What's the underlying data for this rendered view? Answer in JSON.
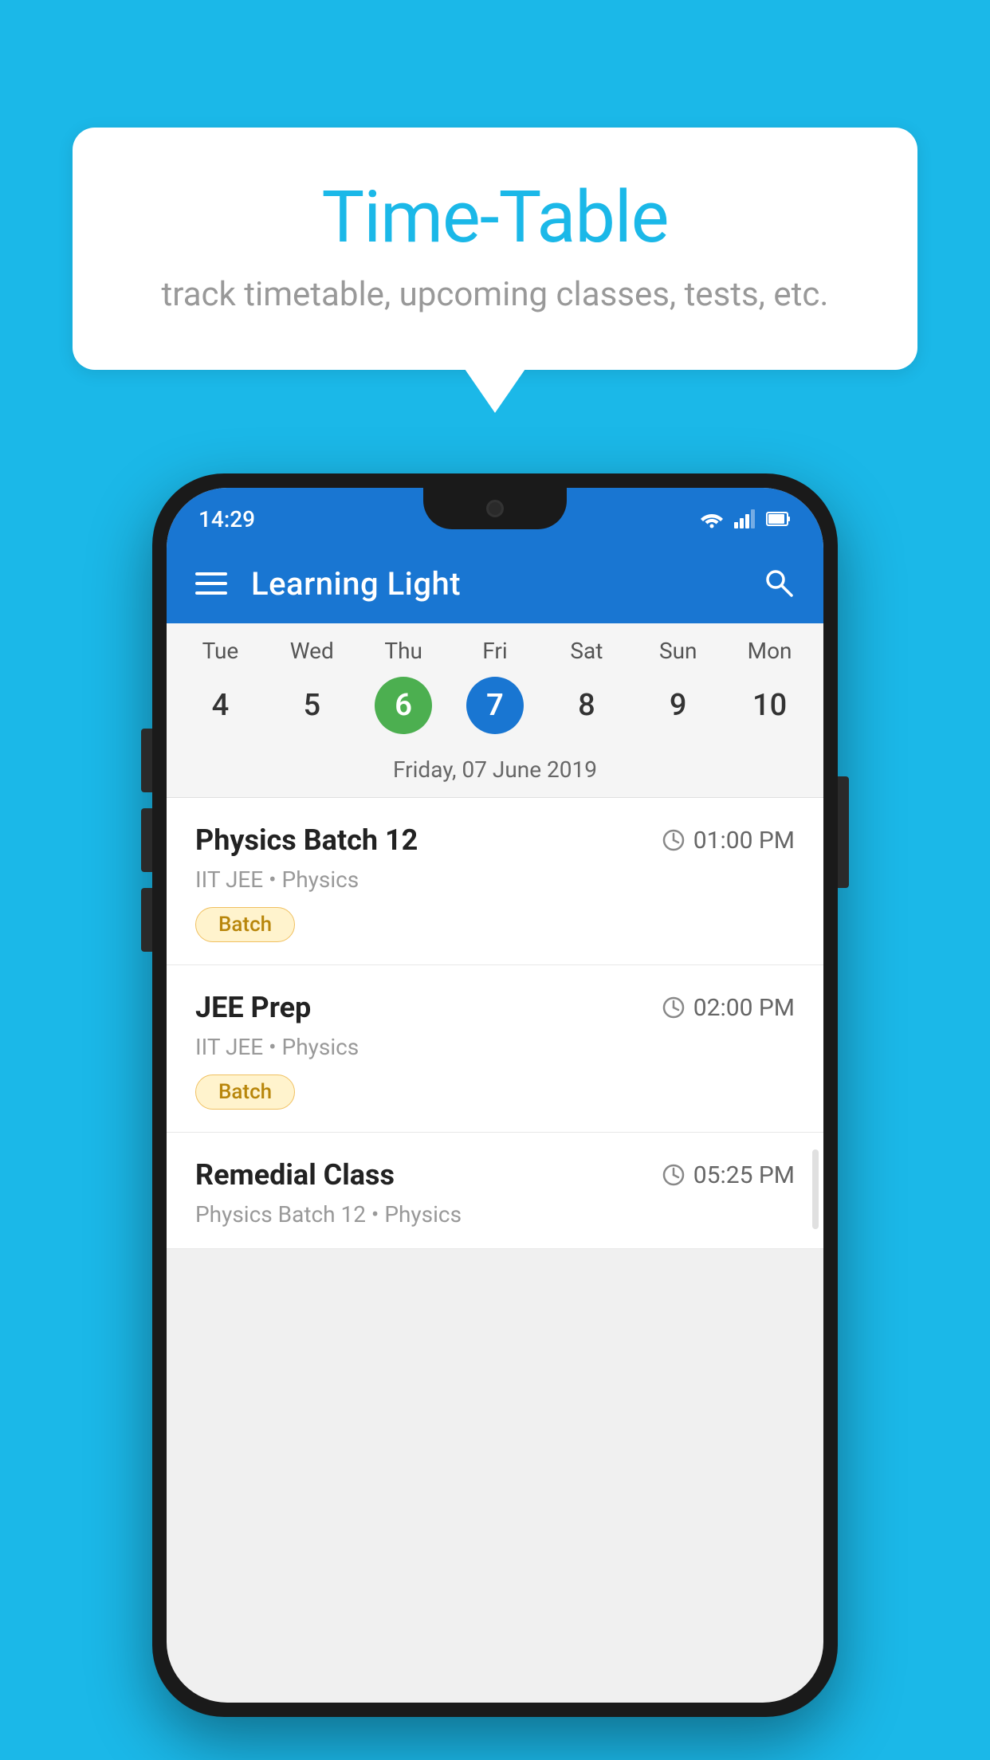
{
  "background": {
    "color": "#1BB8E8"
  },
  "speech_bubble": {
    "title": "Time-Table",
    "subtitle": "track timetable, upcoming classes, tests, etc."
  },
  "phone": {
    "status_bar": {
      "time": "14:29",
      "wifi_icon": "wifi",
      "signal_icon": "signal",
      "battery_icon": "battery"
    },
    "app_bar": {
      "menu_icon": "menu",
      "title": "Learning Light",
      "search_icon": "search"
    },
    "calendar": {
      "days": [
        "Tue",
        "Wed",
        "Thu",
        "Fri",
        "Sat",
        "Sun",
        "Mon"
      ],
      "dates": [
        "4",
        "5",
        "6",
        "7",
        "8",
        "9",
        "10"
      ],
      "today_index": 2,
      "selected_index": 3,
      "selected_label": "Friday, 07 June 2019"
    },
    "schedule": [
      {
        "title": "Physics Batch 12",
        "time": "01:00 PM",
        "subtitle": "IIT JEE • Physics",
        "badge": "Batch"
      },
      {
        "title": "JEE Prep",
        "time": "02:00 PM",
        "subtitle": "IIT JEE • Physics",
        "badge": "Batch"
      },
      {
        "title": "Remedial Class",
        "time": "05:25 PM",
        "subtitle": "Physics Batch 12 • Physics",
        "badge": null
      }
    ]
  }
}
